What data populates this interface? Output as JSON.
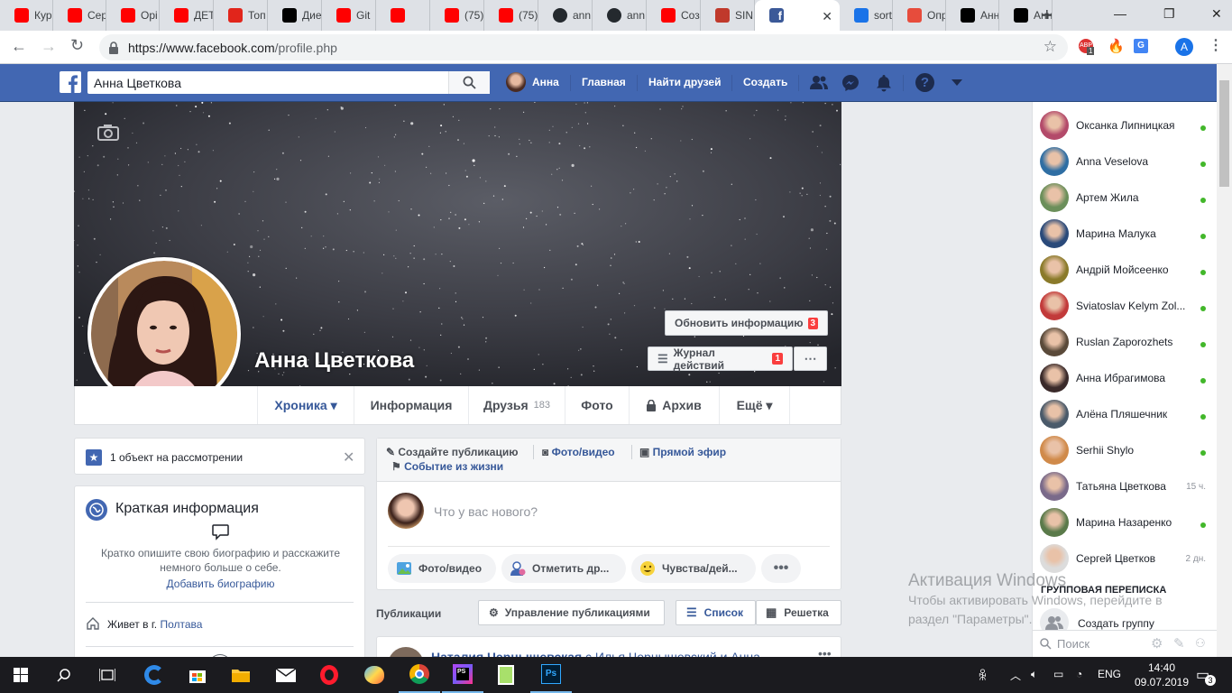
{
  "browser": {
    "tabs": [
      {
        "title": "Кур",
        "icon": "youtube-icon"
      },
      {
        "title": "Сер",
        "icon": "youtube-icon"
      },
      {
        "title": "Орі",
        "icon": "youtube-icon"
      },
      {
        "title": "ДЕТ",
        "icon": "youtube-icon"
      },
      {
        "title": "Топ",
        "icon": "x-icon"
      },
      {
        "title": "Дие",
        "icon": "video-icon"
      },
      {
        "title": "Git",
        "icon": "youtube-icon"
      },
      {
        "title": "",
        "icon": "youtube-icon"
      },
      {
        "title": "(75)",
        "icon": "youtube-icon"
      },
      {
        "title": "(75)",
        "icon": "youtube-icon"
      },
      {
        "title": "ann",
        "icon": "github-icon"
      },
      {
        "title": "ann",
        "icon": "github-icon"
      },
      {
        "title": "Соз",
        "icon": "youtube-icon"
      },
      {
        "title": "SIN",
        "icon": "thermometer-icon"
      },
      {
        "title": "",
        "icon": "facebook-icon"
      },
      {
        "title": "sort",
        "icon": "bookmark-icon"
      },
      {
        "title": "Опр",
        "icon": "gear-icon"
      },
      {
        "title": "Анн",
        "icon": "phpstorm-icon"
      },
      {
        "title": "Анн",
        "icon": "phpstorm-icon"
      }
    ],
    "url_host": "https://www.facebook.com",
    "url_path": "/profile.php",
    "extension_badge": "1",
    "account_initial": "A"
  },
  "fb": {
    "search_value": "Анна Цветкова",
    "nav": {
      "user": "Анна",
      "home": "Главная",
      "find_friends": "Найти друзей",
      "create": "Создать"
    },
    "profile_name": "Анна Цветкова",
    "update_info": {
      "label": "Обновить информацию",
      "badge": "3"
    },
    "activity_log": {
      "label": "Журнал действий",
      "badge": "1"
    },
    "profile_tabs": [
      {
        "label": "Хроника ▾"
      },
      {
        "label": "Информация"
      },
      {
        "label": "Друзья",
        "count": "183"
      },
      {
        "label": "Фото"
      },
      {
        "label": "Архив"
      },
      {
        "label": "Ещё ▾"
      }
    ],
    "review": {
      "text": "1 объект на рассмотрении"
    },
    "intro": {
      "title": "Краткая информация",
      "desc": "Кратко опишите свою биографию и расскажите немного больше о себе.",
      "add_bio": "Добавить биографию",
      "lives_prefix": "Живет в г.",
      "lives_city": "Полтава"
    },
    "composer": {
      "create_post": "Создайте публикацию",
      "photo_video": "Фото/видео",
      "live": "Прямой эфир",
      "life_event": "Событие из жизни",
      "placeholder": "Что у вас нового?",
      "pill_photo": "Фото/видео",
      "pill_tag": "Отметить др...",
      "pill_feeling": "Чувства/дей..."
    },
    "posts_bar": {
      "label": "Публикации",
      "manage": "Управление публикациями",
      "list": "Список",
      "grid": "Решетка"
    },
    "post_preview": {
      "author": "Наталия Чернышевская",
      "rest": "с Илья Чернышевский и Анна"
    },
    "chat": {
      "contacts": [
        {
          "name": "Оксанка Липницкая",
          "status": "online"
        },
        {
          "name": "Anna Veselova",
          "status": "online"
        },
        {
          "name": "Артем Жила",
          "status": "online"
        },
        {
          "name": "Марина Малука",
          "status": "online"
        },
        {
          "name": "Андрій Мойсеенко",
          "status": "online"
        },
        {
          "name": "Sviatoslav Kelym Zol...",
          "status": "online"
        },
        {
          "name": "Ruslan Zaporozhets",
          "status": "online"
        },
        {
          "name": "Анна Ибрагимова",
          "status": "online"
        },
        {
          "name": "Алёна Пляшечник",
          "status": "online"
        },
        {
          "name": "Serhii Shylo",
          "status": "online"
        },
        {
          "name": "Татьяна Цветкова",
          "status": "15 ч."
        },
        {
          "name": "Марина Назаренко",
          "status": "online"
        },
        {
          "name": "Сергей Цветков",
          "status": "2 дн."
        }
      ],
      "group_header": "ГРУППОВАЯ ПЕРЕПИСКА",
      "create_group": "Создать группу",
      "search_placeholder": "Поиск"
    }
  },
  "watermark": {
    "title": "Активация Windows",
    "line1": "Чтобы активировать Windows, перейдите в",
    "line2": "раздел \"Параметры\"."
  },
  "taskbar": {
    "lang": "ENG",
    "time": "14:40",
    "date": "09.07.2019",
    "notif_count": "3"
  },
  "colors": {
    "fb_blue": "#4267b2",
    "fb_link": "#365899",
    "online": "#42b72a",
    "badge_red": "#fa3e3e"
  }
}
